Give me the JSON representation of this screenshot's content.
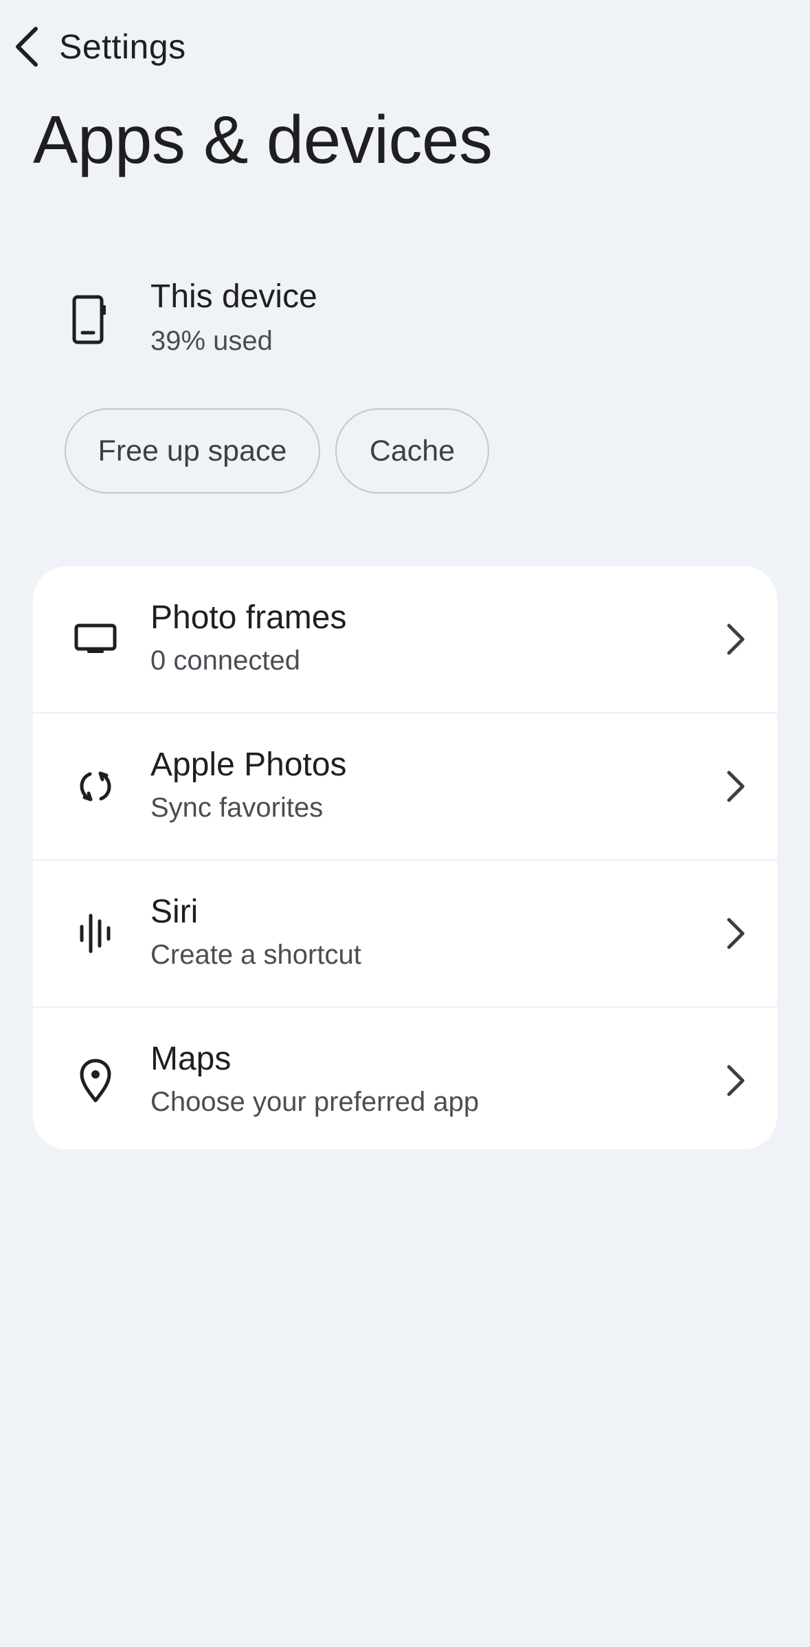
{
  "header": {
    "back_label": "Settings",
    "title": "Apps & devices"
  },
  "device": {
    "title": "This device",
    "subtitle": "39% used",
    "icon": "phone-icon"
  },
  "actions": {
    "free_up_space": "Free up space",
    "cache": "Cache"
  },
  "items": [
    {
      "title": "Photo frames",
      "subtitle": "0 connected",
      "icon": "photo-frame-icon"
    },
    {
      "title": "Apple Photos",
      "subtitle": "Sync favorites",
      "icon": "sync-icon"
    },
    {
      "title": "Siri",
      "subtitle": "Create a shortcut",
      "icon": "voice-waveform-icon"
    },
    {
      "title": "Maps",
      "subtitle": "Choose your preferred app",
      "icon": "map-pin-icon"
    }
  ],
  "colors": {
    "background": "#eff2f7",
    "card": "#ffffff",
    "text_primary": "#1f1f1f",
    "text_secondary": "#4a4d52",
    "chip_border": "#c4c7cc"
  }
}
